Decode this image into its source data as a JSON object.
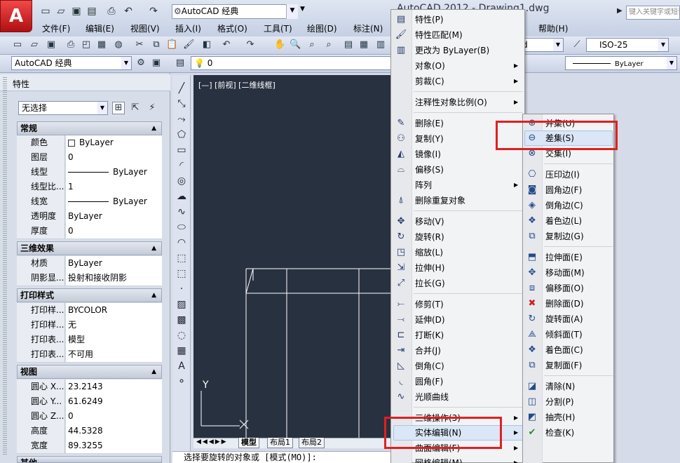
{
  "app": {
    "logo": "A",
    "title": "AutoCAD 2012 - Drawing1.dwg"
  },
  "quick_access": {
    "icons": [
      "new-icon",
      "open-icon",
      "save-icon",
      "saveas-icon",
      "print-icon",
      "undo-icon",
      "redo-icon"
    ],
    "workspace": "AutoCAD 经典"
  },
  "search": {
    "placeholder": "键入关键字或短语"
  },
  "menubar": [
    "文件(F)",
    "编辑(E)",
    "视图(V)",
    "插入(I)",
    "格式(O)",
    "工具(T)",
    "绘图(D)",
    "标注(N)",
    "帮助(H)"
  ],
  "toolbar2": {
    "dim_style": "ISO-25",
    "current_value": "d"
  },
  "toolbar3": {
    "workspace": "AutoCAD 经典",
    "layer": "0",
    "linetype": "ByLayer"
  },
  "properties": {
    "title": "特性",
    "selection": "无选择",
    "groups": [
      {
        "name": "常规",
        "rows": [
          {
            "k": "颜色",
            "v": "ByLayer"
          },
          {
            "k": "图层",
            "v": "0"
          },
          {
            "k": "线型",
            "v": "ByLayer"
          },
          {
            "k": "线型比...",
            "v": "1"
          },
          {
            "k": "线宽",
            "v": "ByLayer"
          },
          {
            "k": "透明度",
            "v": "ByLayer"
          },
          {
            "k": "厚度",
            "v": "0"
          }
        ]
      },
      {
        "name": "三维效果",
        "rows": [
          {
            "k": "材质",
            "v": "ByLayer"
          },
          {
            "k": "阴影显...",
            "v": "投射和接收阴影"
          }
        ]
      },
      {
        "name": "打印样式",
        "rows": [
          {
            "k": "打印样...",
            "v": "BYCOLOR"
          },
          {
            "k": "打印样...",
            "v": "无"
          },
          {
            "k": "打印表...",
            "v": "模型"
          },
          {
            "k": "打印表...",
            "v": "不可用"
          }
        ]
      },
      {
        "name": "视图",
        "rows": [
          {
            "k": "圆心 X...",
            "v": "23.2143"
          },
          {
            "k": "圆心 Y...",
            "v": "61.6249"
          },
          {
            "k": "圆心 Z...",
            "v": "0"
          },
          {
            "k": "高度",
            "v": "44.5328"
          },
          {
            "k": "宽度",
            "v": "89.3255"
          }
        ]
      },
      {
        "name": "其他",
        "rows": []
      }
    ]
  },
  "viewport": {
    "label": "[—] [前视] [二维线框]",
    "axis_y": "Y"
  },
  "layout_tabs": [
    "模型",
    "布局1",
    "布局2"
  ],
  "command_line": "选择要旋转的对象或 [模式(MO)]:",
  "context_menu": [
    {
      "label": "特性(P)",
      "icon": "properties-icon"
    },
    {
      "label": "特性匹配(M)",
      "icon": "match-properties-icon"
    },
    {
      "label": "更改为 ByLayer(B)",
      "icon": "bylayer-icon"
    },
    {
      "label": "对象(O)",
      "submenu": true
    },
    {
      "label": "剪裁(C)",
      "submenu": true
    },
    {
      "label": "注释性对象比例(O)",
      "submenu": true
    },
    {
      "label": "删除(E)",
      "icon": "erase-icon"
    },
    {
      "label": "复制(Y)",
      "icon": "copy-icon"
    },
    {
      "label": "镜像(I)",
      "icon": "mirror-icon"
    },
    {
      "label": "偏移(S)",
      "icon": "offset-icon"
    },
    {
      "label": "阵列",
      "submenu": true
    },
    {
      "label": "删除重复对象",
      "icon": "overkill-icon"
    },
    {
      "label": "移动(V)",
      "icon": "move-icon"
    },
    {
      "label": "旋转(R)",
      "icon": "rotate-icon"
    },
    {
      "label": "缩放(L)",
      "icon": "scale-icon"
    },
    {
      "label": "拉伸(H)",
      "icon": "stretch-icon"
    },
    {
      "label": "拉长(G)",
      "icon": "lengthen-icon"
    },
    {
      "label": "修剪(T)",
      "icon": "trim-icon"
    },
    {
      "label": "延伸(D)",
      "icon": "extend-icon"
    },
    {
      "label": "打断(K)",
      "icon": "break-icon"
    },
    {
      "label": "合并(J)",
      "icon": "join-icon"
    },
    {
      "label": "倒角(C)",
      "icon": "chamfer-icon"
    },
    {
      "label": "圆角(F)",
      "icon": "fillet-icon"
    },
    {
      "label": "光顺曲线",
      "icon": "blend-icon"
    },
    {
      "label": "三维操作(3)",
      "submenu": true
    },
    {
      "label": "实体编辑(N)",
      "submenu": true,
      "highlighted": true
    },
    {
      "label": "曲面编辑(F)",
      "submenu": true
    },
    {
      "label": "网格编辑(M)",
      "submenu": true
    }
  ],
  "solid_edit_submenu": [
    {
      "label": "并集(U)",
      "icon": "union-icon"
    },
    {
      "label": "差集(S)",
      "icon": "subtract-icon",
      "highlighted": true
    },
    {
      "label": "交集(I)",
      "icon": "intersect-icon"
    },
    {
      "label": "压印边(I)",
      "icon": "imprint-icon"
    },
    {
      "label": "圆角边(F)",
      "icon": "fillet-edge-icon"
    },
    {
      "label": "倒角边(C)",
      "icon": "chamfer-edge-icon"
    },
    {
      "label": "着色边(L)",
      "icon": "color-edge-icon"
    },
    {
      "label": "复制边(G)",
      "icon": "copy-edge-icon"
    },
    {
      "label": "拉伸面(E)",
      "icon": "extrude-face-icon"
    },
    {
      "label": "移动面(M)",
      "icon": "move-face-icon"
    },
    {
      "label": "偏移面(O)",
      "icon": "offset-face-icon"
    },
    {
      "label": "删除面(D)",
      "icon": "delete-face-icon"
    },
    {
      "label": "旋转面(A)",
      "icon": "rotate-face-icon"
    },
    {
      "label": "倾斜面(T)",
      "icon": "taper-face-icon"
    },
    {
      "label": "着色面(C)",
      "icon": "color-face-icon"
    },
    {
      "label": "复制面(F)",
      "icon": "copy-face-icon"
    },
    {
      "label": "清除(N)",
      "icon": "clean-icon"
    },
    {
      "label": "分割(P)",
      "icon": "separate-icon"
    },
    {
      "label": "抽壳(H)",
      "icon": "shell-icon"
    },
    {
      "label": "检查(K)",
      "icon": "check-icon"
    }
  ]
}
